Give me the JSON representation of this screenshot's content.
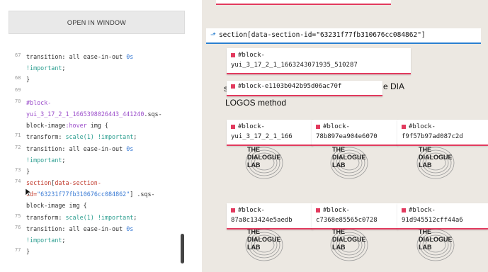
{
  "left": {
    "open_button": "OPEN IN WINDOW",
    "code_lines": [
      {
        "num": "67",
        "parts": [
          [
            "",
            "transition: all ease-in-out "
          ],
          [
            "num",
            "0s"
          ]
        ]
      },
      {
        "num": "",
        "parts": [
          [
            "kw",
            "!important"
          ],
          [
            "",
            ";"
          ]
        ]
      },
      {
        "num": "68",
        "parts": [
          [
            "",
            "}"
          ]
        ]
      },
      {
        "num": "69",
        "parts": [
          [
            "",
            ""
          ]
        ]
      },
      {
        "num": "70",
        "parts": [
          [
            "sel",
            "#block-"
          ]
        ]
      },
      {
        "num": "",
        "parts": [
          [
            "sel",
            "yui_3_17_2_1_1665398026443_441240"
          ],
          [
            "",
            ".sqs-"
          ]
        ]
      },
      {
        "num": "",
        "parts": [
          [
            "",
            "block-image"
          ],
          [
            "sel",
            ":hover"
          ],
          [
            "",
            " img {"
          ]
        ]
      },
      {
        "num": "71",
        "parts": [
          [
            "",
            "transform: "
          ],
          [
            "kw",
            "scale(1)"
          ],
          [
            "",
            " "
          ],
          [
            "kw",
            "!important"
          ],
          [
            "",
            ";"
          ]
        ]
      },
      {
        "num": "72",
        "parts": [
          [
            "",
            "transition: all ease-in-out "
          ],
          [
            "num",
            "0s"
          ]
        ]
      },
      {
        "num": "",
        "parts": [
          [
            "kw",
            "!important"
          ],
          [
            "",
            ";"
          ]
        ]
      },
      {
        "num": "73",
        "parts": [
          [
            "",
            "}"
          ]
        ]
      },
      {
        "num": "74",
        "parts": [
          [
            "sel2",
            "section"
          ],
          [
            "",
            "["
          ],
          [
            "sel2",
            "data-section-"
          ]
        ]
      },
      {
        "num": "",
        "parts": [
          [
            "sel2",
            "id="
          ],
          [
            "str",
            "\"63231f77fb310676cc084862\""
          ],
          [
            "",
            "] .sqs-"
          ]
        ]
      },
      {
        "num": "",
        "parts": [
          [
            "",
            "block-image img {"
          ]
        ]
      },
      {
        "num": "75",
        "parts": [
          [
            "",
            "transform: "
          ],
          [
            "kw",
            "scale(1)"
          ],
          [
            "",
            " "
          ],
          [
            "kw",
            "!important"
          ],
          [
            "",
            ";"
          ]
        ]
      },
      {
        "num": "76",
        "parts": [
          [
            "",
            "transition: all ease-in-out "
          ],
          [
            "num",
            "0s"
          ]
        ]
      },
      {
        "num": "",
        "parts": [
          [
            "kw",
            "!important"
          ],
          [
            "",
            ";"
          ]
        ]
      },
      {
        "num": "77",
        "parts": [
          [
            "",
            "}"
          ]
        ]
      }
    ]
  },
  "right": {
    "section_tag": "section[data-section-id=\"63231f77fb310676cc084862\"]",
    "block_yui_top": "#block-",
    "block_yui_top2": "yui_3_17_2_1_1663243071935_510287",
    "block_e110": "#block-e1103b042b95d06ac70f",
    "text_s": "s",
    "text_e_dia": "e DIA",
    "text_logos": "LOGOS method",
    "row1": [
      {
        "l1": "#block-",
        "l2": "yui_3_17_2_1_166"
      },
      {
        "l1": "#block-",
        "l2": "78b897ea904e6070"
      },
      {
        "l1": "#block-",
        "l2": "f9f57b97ad087c2d"
      }
    ],
    "row2": [
      {
        "l1": "#block-",
        "l2": "87a8c13424e5aedb"
      },
      {
        "l1": "#block-",
        "l2": "c7368e85565c0728"
      },
      {
        "l1": "#block-",
        "l2": "91d945512cff44a6"
      }
    ],
    "logo_text": [
      "THE",
      "DIALOGUE",
      "LAB"
    ]
  },
  "colors": {
    "accent_red": "#e23a5e",
    "accent_blue": "#2a7fd0",
    "canvas_bg": "#ece8e2"
  }
}
